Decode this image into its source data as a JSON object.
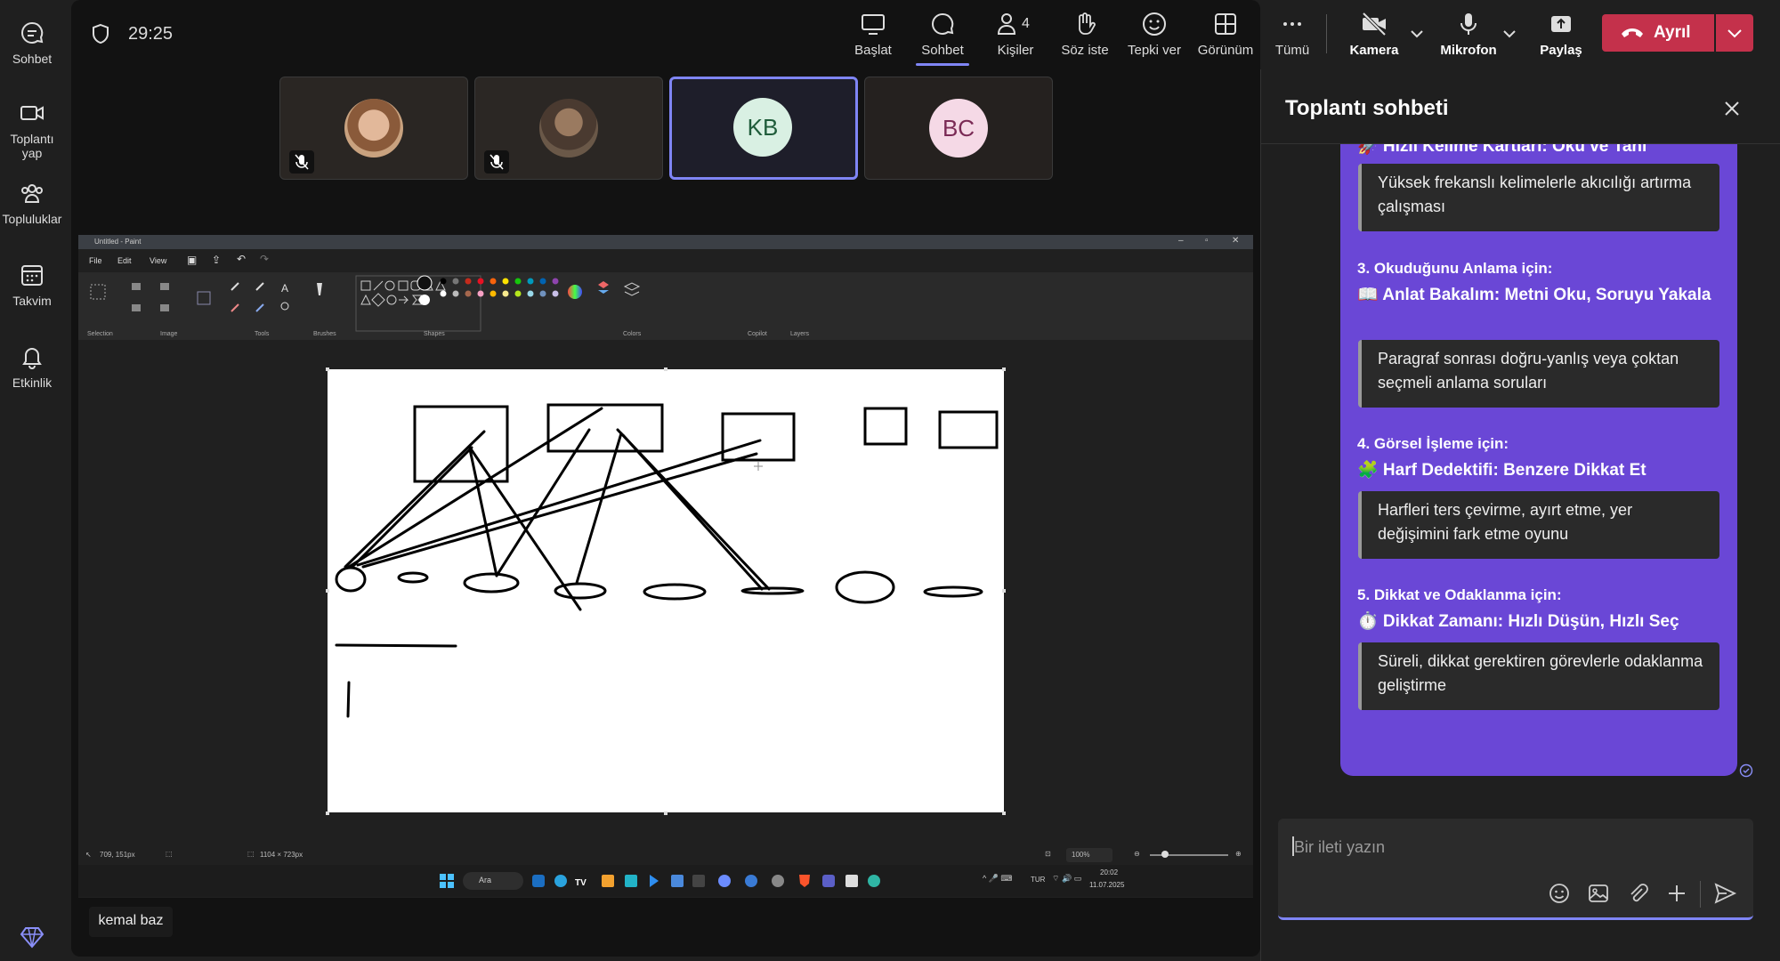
{
  "rail": {
    "items": [
      {
        "label": "Sohbet",
        "icon": "chat-icon"
      },
      {
        "label": "Toplantı yap",
        "icon": "video-icon"
      },
      {
        "label": "Topluluklar",
        "icon": "communities-icon"
      },
      {
        "label": "Takvim",
        "icon": "calendar-icon"
      },
      {
        "label": "Etkinlik",
        "icon": "bell-icon"
      }
    ],
    "bottom_icon": "diamond-icon"
  },
  "meeting": {
    "timer": "29:25",
    "participant_count": "4",
    "toolbar": {
      "start": "Başlat",
      "chat": "Sohbet",
      "people": "Kişiler",
      "raise_hand": "Söz iste",
      "react": "Tepki ver",
      "view": "Görünüm",
      "more": "Tümü",
      "camera": "Kamera",
      "mic": "Mikrofon",
      "share": "Paylaş",
      "leave": "Ayrıl"
    },
    "participants": [
      {
        "initials": "",
        "muted": true
      },
      {
        "initials": "",
        "muted": true
      },
      {
        "initials": "KB",
        "muted": false,
        "active": true
      },
      {
        "initials": "BC",
        "muted": false
      }
    ],
    "presenter_name": "kemal baz"
  },
  "paint": {
    "title": "Untitled - Paint",
    "menu": [
      "File",
      "Edit",
      "View"
    ],
    "groups": [
      "Selection",
      "Image",
      "Tools",
      "Brushes",
      "Shapes",
      "Colors",
      "Copilot",
      "Layers"
    ],
    "status_cursor": "709, 151px",
    "status_size": "1104 × 723px",
    "zoom": "100%",
    "taskbar_search": "Ara",
    "tray_lang": "TUR",
    "tray_time": "20:02",
    "tray_date": "11.07.2025"
  },
  "chat": {
    "title": "Toplantı sohbeti",
    "partial_top": "🚀 Hızlı Kelime Kartları: Oku ve Tanı",
    "card1": "Yüksek frekanslı kelimelerle akıcılığı artırma çalışması",
    "sections": [
      {
        "heading": "3. Okuduğunu Anlama için:",
        "title": "📖 Anlat Bakalım: Metni Oku, Soruyu Yakala",
        "desc": "Paragraf sonrası doğru-yanlış veya çoktan seçmeli anlama soruları"
      },
      {
        "heading": "4. Görsel İşleme için:",
        "title": "🧩 Harf Dedektifi: Benzere Dikkat Et",
        "desc": "Harfleri ters çevirme, ayırt etme, yer değişimini fark etme oyunu"
      },
      {
        "heading": "5. Dikkat ve Odaklanma için:",
        "title": "⏱️ Dikkat Zamanı: Hızlı Düşün, Hızlı Seç",
        "desc": "Süreli, dikkat gerektiren görevlerle odaklanma geliştirme"
      }
    ],
    "compose_placeholder": "Bir ileti yazın"
  },
  "colors": {
    "accent": "#7f85f5",
    "bubble": "#6a47d6",
    "leave": "#c4314b"
  }
}
